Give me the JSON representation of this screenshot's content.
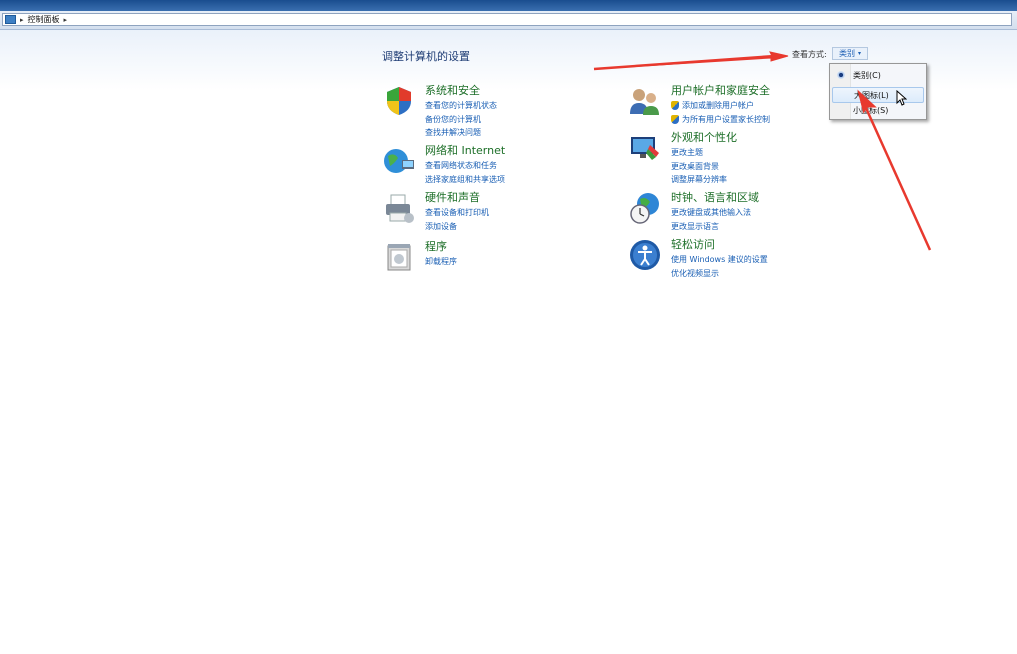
{
  "breadcrumb": {
    "location": "控制面板",
    "sep": "▸"
  },
  "page": {
    "title": "调整计算机的设置"
  },
  "view_by": {
    "label": "查看方式:",
    "value": "类别",
    "caret": "▾"
  },
  "dropdown": {
    "items": [
      {
        "label": "类别(C)",
        "selected": true
      },
      {
        "label": "大图标(L)",
        "selected": false
      },
      {
        "label": "小图标(S)",
        "selected": false
      }
    ]
  },
  "categories": {
    "system_security": {
      "title": "系统和安全",
      "links": [
        "查看您的计算机状态",
        "备份您的计算机",
        "查找并解决问题"
      ],
      "icon": "shield-icon"
    },
    "network": {
      "title": "网络和 Internet",
      "links": [
        "查看网络状态和任务",
        "选择家庭组和共享选项"
      ],
      "icon": "network-globe-icon"
    },
    "hardware": {
      "title": "硬件和声音",
      "links": [
        "查看设备和打印机",
        "添加设备"
      ],
      "icon": "printer-icon"
    },
    "programs": {
      "title": "程序",
      "links": [
        "卸载程序"
      ],
      "icon": "programs-icon"
    },
    "user_accounts": {
      "title": "用户帐户和家庭安全",
      "links": [
        "添加或删除用户帐户",
        "为所有用户设置家长控制"
      ],
      "icon": "users-icon"
    },
    "appearance": {
      "title": "外观和个性化",
      "links": [
        "更改主题",
        "更改桌面背景",
        "调整屏幕分辨率"
      ],
      "icon": "monitor-icon"
    },
    "clock": {
      "title": "时钟、语言和区域",
      "links": [
        "更改键盘或其他输入法",
        "更改显示语言"
      ],
      "icon": "globe-clock-icon"
    },
    "ease": {
      "title": "轻松访问",
      "links": [
        "使用 Windows 建议的设置",
        "优化视频显示"
      ],
      "icon": "ease-of-access-icon"
    }
  },
  "colors": {
    "category_title": "#1c6e27",
    "link": "#1a5fb4",
    "annotation_arrow": "#e8392e"
  }
}
